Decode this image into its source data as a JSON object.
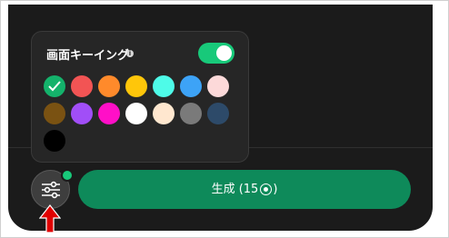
{
  "popover": {
    "title": "画面キーイング",
    "info_icon": "i",
    "toggle_on": true
  },
  "swatches": [
    {
      "color": "#14b26b",
      "selected": true
    },
    {
      "color": "#f25454"
    },
    {
      "color": "#ff8a2b"
    },
    {
      "color": "#ffc60a"
    },
    {
      "color": "#4efbe8"
    },
    {
      "color": "#3da3f7"
    },
    {
      "color": "#fcd9d9"
    },
    {
      "color": "#7a5212"
    },
    {
      "color": "#a14ef7"
    },
    {
      "color": "#ff0fc7"
    },
    {
      "color": "#ffffff"
    },
    {
      "color": "#ffe7cf"
    },
    {
      "color": "#7a7a7a"
    },
    {
      "color": "#2d4a69"
    },
    {
      "color": "#000000"
    }
  ],
  "generate_button": {
    "label_prefix": "生成 (15",
    "label_suffix": ")",
    "icon": "coin-icon"
  },
  "settings_button": {
    "icon": "sliders-icon",
    "badge_color": "#18c97a"
  },
  "annotation": {
    "icon": "red-arrow-up-icon",
    "color": "#e00000"
  }
}
